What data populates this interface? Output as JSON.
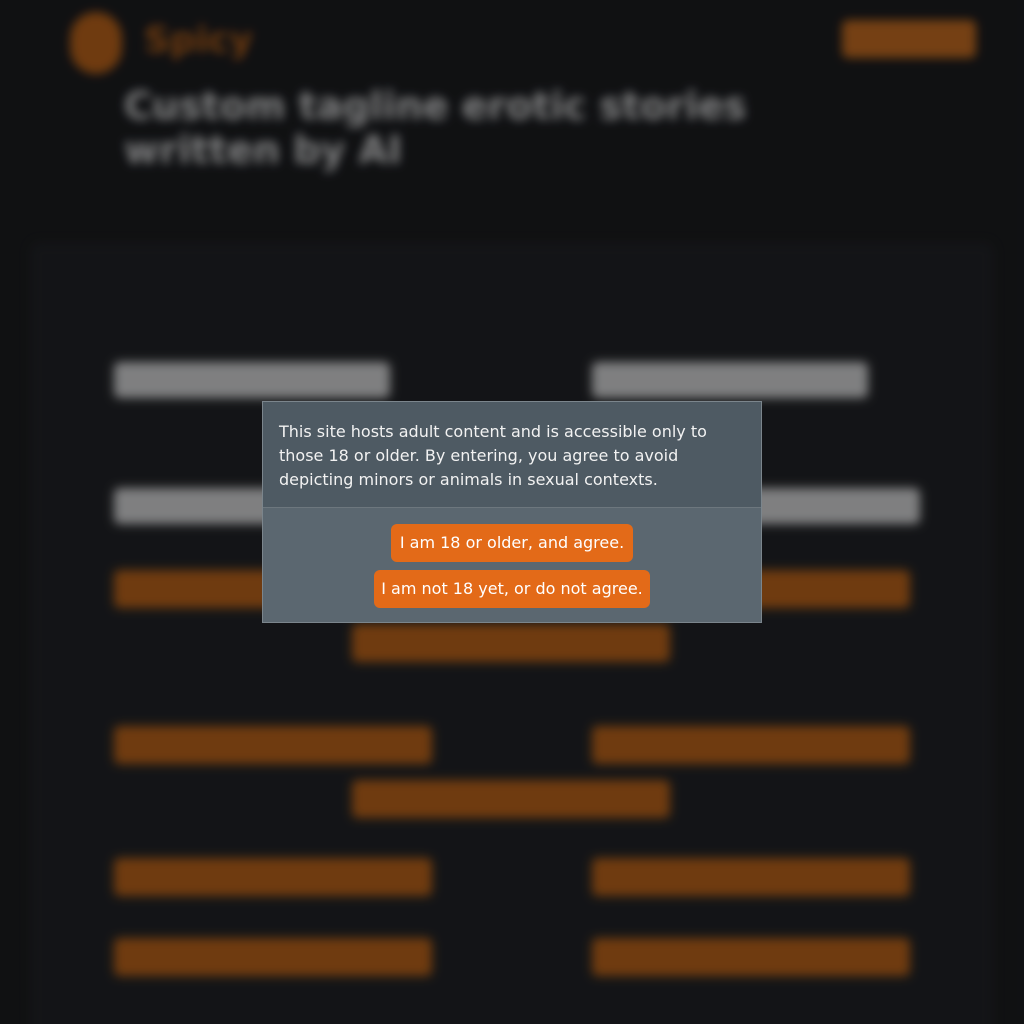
{
  "background": {
    "logo_text": "Spicy",
    "nav_link": "",
    "nav_button": "",
    "hero_title": "Custom tagline erotic stories written by AI",
    "hero_sub_1": "",
    "hero_sub_2": "",
    "tabs": [
      "",
      ""
    ],
    "field_labels": [
      "",
      "",
      "",
      ""
    ],
    "buttons": [
      "",
      "",
      "",
      "",
      "",
      "",
      "",
      "",
      "",
      "",
      "",
      ""
    ]
  },
  "modal": {
    "message": "This site hosts adult content and is accessible only to those 18 or older. By entering, you agree to avoid depicting minors or animals in sexual contexts.",
    "agree_label": "I am 18 or older, and agree.",
    "decline_label": "I am not 18 yet, or do not agree."
  },
  "colors": {
    "accent": "#e36a18",
    "modal_bg": "#5b6770",
    "page_bg": "#111214"
  }
}
